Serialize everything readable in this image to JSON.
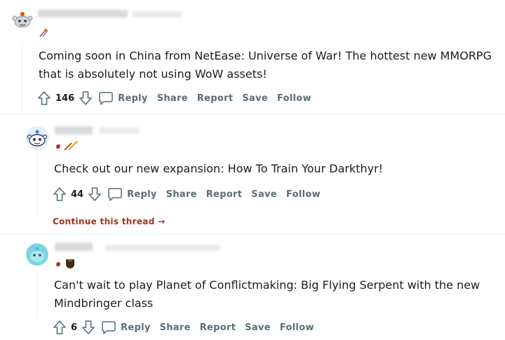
{
  "comments": [
    {
      "text_lines": [
        "Coming soon in China from NetEase: Universe of War! The hottest new MMORPG",
        "that is absolutely not using WoW assets!"
      ],
      "upvotes": "146"
    },
    {
      "text_lines": [
        "Check out our new expansion: How To Train Your Darkthyr!"
      ],
      "upvotes": "44"
    },
    {
      "text_lines": [
        "Can't wait to play Planet of Conflictmaking: Big Flying Serpent with the new",
        "Mindbringer class"
      ],
      "upvotes": "6"
    }
  ],
  "actions": {
    "reply": "Reply",
    "share": "Share",
    "report": "Report",
    "save": "Save",
    "follow": "Follow"
  },
  "continue_thread": "Continue this thread",
  "continue_arrow": "→",
  "colors": {
    "action_text": "#576f76",
    "continue_link": "#a0331a",
    "divider": "#edeff1"
  },
  "icons": [
    "upvote-icon",
    "downvote-icon",
    "reply-bubble-icon",
    "avatar-icon",
    "flair-icon"
  ]
}
